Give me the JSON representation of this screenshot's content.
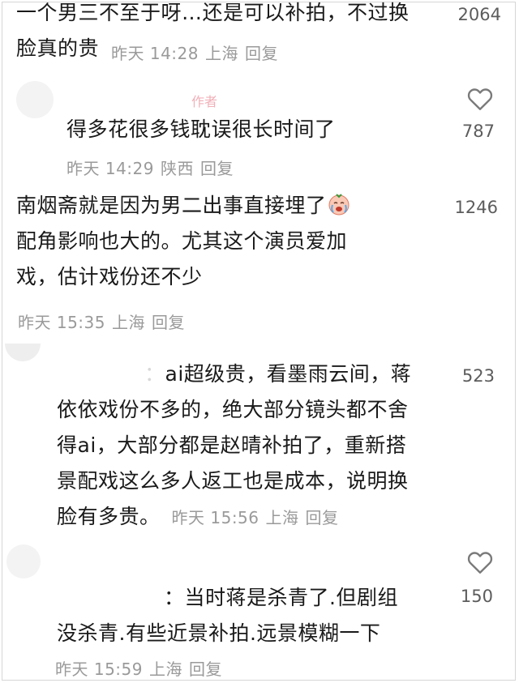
{
  "comments": [
    {
      "lines": [
        "一个男三不至于呀…还是可以补拍，不过换",
        "脸真的贵"
      ],
      "date": "昨天 14:28",
      "location": "上海",
      "reply": "回复",
      "likes": "2064"
    },
    {
      "lines": [
        "得多花很多钱耽误很长时间了"
      ],
      "date": "昨天 14:29",
      "location": "陕西",
      "reply": "回复",
      "likes": "787",
      "tag": "作者"
    },
    {
      "lines": [
        "南烟斋就是因为男二出事直接埋了",
        "配角影响也大的。尤其这个演员爱加",
        "戏，估计戏份还不少"
      ],
      "date": "昨天 15:35",
      "location": "上海",
      "reply": "回复",
      "likes": "1246",
      "emoji": "crying-face-emoji"
    },
    {
      "lines": [
        "ai超级贵，看墨雨云间，蒋",
        "依依戏份不多的，绝大部分镜头都不舍",
        "得ai，大部分都是赵晴补拍了，重新搭",
        "景配戏这么多人返工也是成本，说明换",
        "脸有多贵。"
      ],
      "prefix": "：",
      "date": "昨天 15:56",
      "location": "上海",
      "reply": "回复",
      "likes": "523"
    },
    {
      "lines": [
        "：当时蒋是杀青了.但剧组",
        "没杀青.有些近景补拍.远景模糊一下"
      ],
      "date": "昨天 15:59",
      "location": "上海",
      "reply": "回复",
      "likes": "150"
    }
  ],
  "icons": {
    "like": "heart-outline-icon"
  },
  "colors": {
    "text": "#1a1a1a",
    "meta": "#9a9a9a",
    "count": "#5c5c5c"
  }
}
